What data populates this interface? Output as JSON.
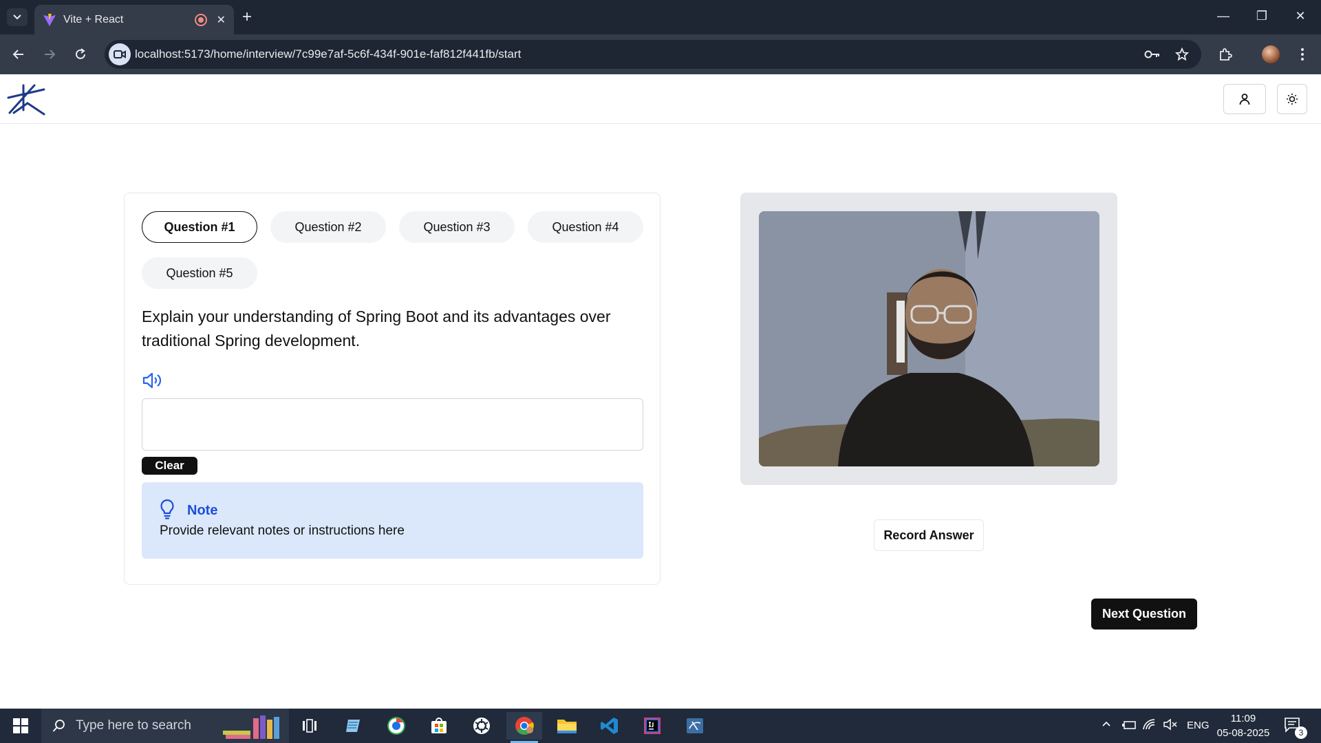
{
  "browser": {
    "tab_title": "Vite + React",
    "tab_close": "✕",
    "new_tab": "+",
    "url": "localhost:5173/home/interview/7c99e7af-5c6f-434f-901e-faf812f441fb/start",
    "window_controls": {
      "minimize": "—",
      "restore": "❐",
      "close": "✕"
    }
  },
  "interview": {
    "question_tabs": [
      "Question #1",
      "Question #2",
      "Question #3",
      "Question #4",
      "Question #5"
    ],
    "active_question": "Question #1",
    "question_text": "Explain your understanding of Spring Boot and its advantages over traditional Spring development.",
    "answer_value": "",
    "clear_label": "Clear",
    "note": {
      "title": "Note",
      "text": "Provide relevant notes or instructions here"
    },
    "record_label": "Record Answer",
    "next_label": "Next Question"
  },
  "taskbar": {
    "search_placeholder": "Type here to search",
    "language": "ENG",
    "time": "11:09",
    "date": "05-08-2025",
    "notification_count": "3"
  },
  "colors": {
    "accent_blue": "#1d4ed8",
    "note_bg": "#dbe7fb",
    "primary_dark": "#111111",
    "chrome_dark": "#1f2633"
  }
}
